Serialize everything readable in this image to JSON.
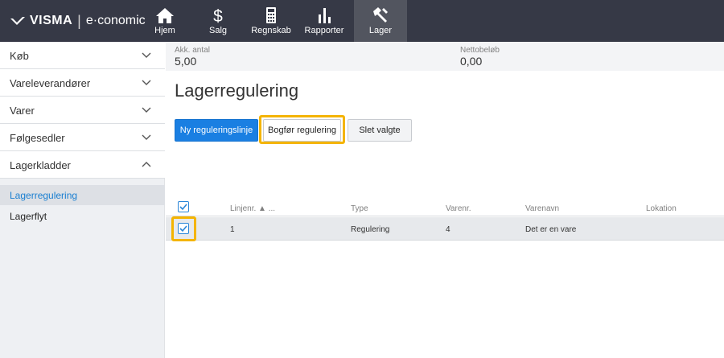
{
  "header": {
    "brand": "VISMA",
    "separator": "|",
    "product": "e·conomic",
    "nav": [
      {
        "label": "Hjem",
        "icon": "home-icon"
      },
      {
        "label": "Salg",
        "icon": "dollar-icon"
      },
      {
        "label": "Regnskab",
        "icon": "calculator-icon"
      },
      {
        "label": "Rapporter",
        "icon": "bar-chart-icon"
      },
      {
        "label": "Lager",
        "icon": "hammer-icon",
        "active": true
      }
    ]
  },
  "sidebar": {
    "sections": [
      {
        "label": "Køb",
        "expanded": false
      },
      {
        "label": "Vareleverandører",
        "expanded": false
      },
      {
        "label": "Varer",
        "expanded": false
      },
      {
        "label": "Følgesedler",
        "expanded": false
      },
      {
        "label": "Lagerkladder",
        "expanded": true
      }
    ],
    "items": [
      {
        "label": "Lagerregulering",
        "active": true
      },
      {
        "label": "Lagerflyt",
        "active": false
      }
    ]
  },
  "summary": {
    "qty_label": "Akk. antal",
    "qty_value": "5,00",
    "net_label": "Nettobeløb",
    "net_value": "0,00"
  },
  "page": {
    "title": "Lagerregulering"
  },
  "actions": {
    "new_line": "Ny reguleringslinje",
    "post": "Bogfør regulering",
    "delete": "Slet valgte"
  },
  "table": {
    "columns": [
      "Linjenr. ▲ ...",
      "Type",
      "Varenr.",
      "Varenavn",
      "Lokation"
    ],
    "rows": [
      {
        "line": "1",
        "type": "Regulering",
        "item_no": "4",
        "item_name": "Det er en vare",
        "location": "",
        "checked": true
      }
    ],
    "header_checked": true
  },
  "colors": {
    "topbar": "#363946",
    "accent": "#1a7fe2",
    "highlight": "#f4b400"
  }
}
